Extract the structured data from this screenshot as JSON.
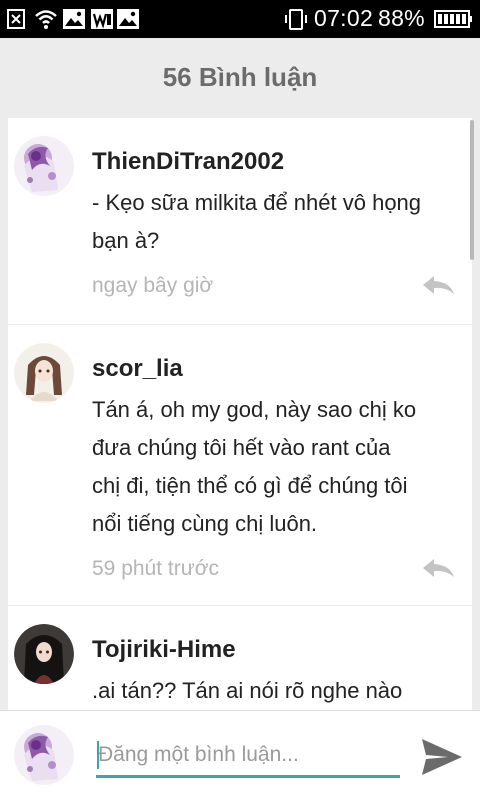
{
  "status_bar": {
    "icons": [
      "close-box-icon",
      "wifi-icon",
      "image-icon",
      "word-icon",
      "image-icon",
      "phone-vibrate-icon",
      "battery-icon"
    ],
    "time": "07:02",
    "battery": "88%"
  },
  "header": {
    "title": "56 Bình luận"
  },
  "comments": [
    {
      "username": "ThienDiTran2002",
      "text": "- Kẹo sữa milkita để nhét vô họng\nbạn à?",
      "time": "ngay bây giờ",
      "avatar": "anime-avatar-purple-icon"
    },
    {
      "username": "scor_lia",
      "text": "Tán á,  oh my god, này sao chị ko\nđưa chúng tôi hết vào rant của\nchị đi,  tiện thể có gì để chúng tôi\nnổi tiếng cùng chị luôn.",
      "time": "59 phút trước",
      "avatar": "anime-avatar-girl-icon"
    },
    {
      "username": "Tojiriki-Hime",
      "text": ".ai tán?? Tán ai nói rõ nghe nào",
      "time": "",
      "avatar": "anime-avatar-dark-icon"
    }
  ],
  "composer": {
    "placeholder": "Đăng một bình luận...",
    "value": "",
    "send_icon": "send-icon",
    "accent": "#3aa8a8"
  }
}
